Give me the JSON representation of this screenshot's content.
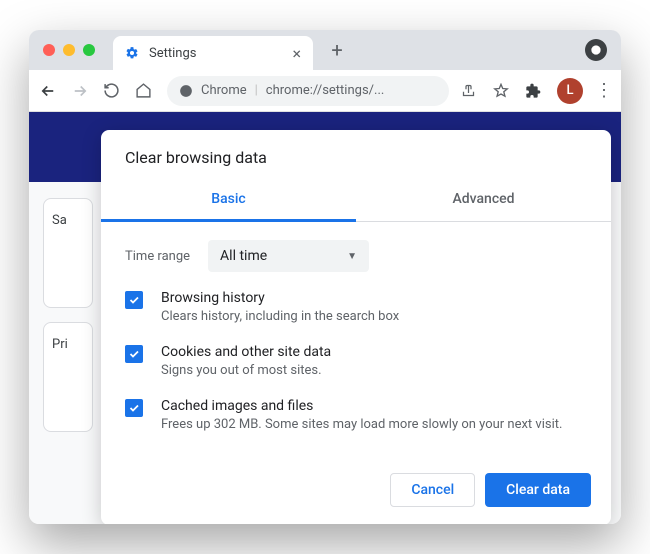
{
  "titlebar": {
    "tab_title": "Settings",
    "avatar_letter": "L"
  },
  "toolbar": {
    "url_prefix": "Chrome",
    "url": "chrome://settings/..."
  },
  "background": {
    "card1_label": "Sa",
    "card2_label": "Pri"
  },
  "dialog": {
    "title": "Clear browsing data",
    "tabs": {
      "basic": "Basic",
      "advanced": "Advanced"
    },
    "time_range_label": "Time range",
    "time_range_value": "All time",
    "items": [
      {
        "title": "Browsing history",
        "desc": "Clears history, including in the search box"
      },
      {
        "title": "Cookies and other site data",
        "desc": "Signs you out of most sites."
      },
      {
        "title": "Cached images and files",
        "desc": "Frees up 302 MB. Some sites may load more slowly on your next visit."
      }
    ],
    "cancel": "Cancel",
    "clear": "Clear data"
  }
}
